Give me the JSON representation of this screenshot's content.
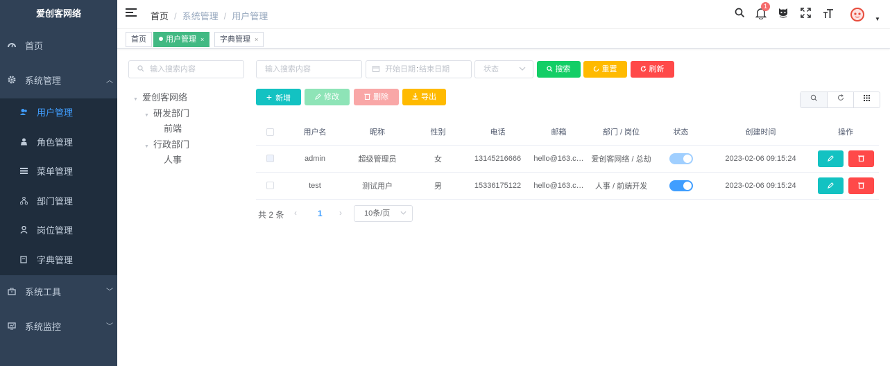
{
  "sidebar": {
    "logo": "爱创客网络",
    "menu": [
      {
        "label": "首页",
        "icon": "dashboard-icon"
      },
      {
        "label": "系统管理",
        "icon": "gear-icon",
        "expanded": true
      },
      {
        "label": "系统工具",
        "icon": "toolbox-icon"
      },
      {
        "label": "系统监控",
        "icon": "monitor-icon"
      }
    ],
    "submenu": [
      {
        "label": "用户管理",
        "icon": "user-icon",
        "active": true
      },
      {
        "label": "角色管理",
        "icon": "role-icon"
      },
      {
        "label": "菜单管理",
        "icon": "menu-icon"
      },
      {
        "label": "部门管理",
        "icon": "org-icon"
      },
      {
        "label": "岗位管理",
        "icon": "post-icon"
      },
      {
        "label": "字典管理",
        "icon": "dict-icon"
      }
    ]
  },
  "navbar": {
    "breadcrumb": [
      "首页",
      "系统管理",
      "用户管理"
    ],
    "bell_badge": "1",
    "icons": [
      "search-icon",
      "bell-icon",
      "github-icon",
      "fullscreen-icon",
      "font-size-icon",
      "avatar-icon"
    ]
  },
  "tags": [
    {
      "label": "首页"
    },
    {
      "label": "用户管理",
      "active": true
    },
    {
      "label": "字典管理"
    }
  ],
  "tree": {
    "search_placeholder": "输入搜索内容",
    "nodes": [
      {
        "label": "爱创客网络",
        "level": 0,
        "expanded": true
      },
      {
        "label": "研发部门",
        "level": 1,
        "expanded": true
      },
      {
        "label": "前端",
        "level": 2
      },
      {
        "label": "行政部门",
        "level": 1,
        "expanded": true
      },
      {
        "label": "人事",
        "level": 2
      }
    ]
  },
  "filters": {
    "keyword_placeholder": "输入搜索内容",
    "start_placeholder": "开始日期",
    "range_separator": ":",
    "end_placeholder": "结束日期",
    "status_placeholder": "状态",
    "search_label": "搜索",
    "reset_label": "重置",
    "refresh_label": "刷新"
  },
  "toolbar": {
    "add_label": "新增",
    "edit_label": "修改",
    "delete_label": "删除",
    "export_label": "导出"
  },
  "table": {
    "columns": [
      "用户名",
      "昵称",
      "性别",
      "电话",
      "邮箱",
      "部门 / 岗位",
      "状态",
      "创建时间",
      "操作"
    ],
    "rows": [
      {
        "username": "admin",
        "nickname": "超级管理员",
        "gender": "女",
        "phone": "13145216666",
        "email": "hello@163.c…",
        "dept": "爱创客网络 / 总劫",
        "enabled": true,
        "disabled_row": true,
        "created": "2023-02-06 09:15:24"
      },
      {
        "username": "test",
        "nickname": "测试用户",
        "gender": "男",
        "phone": "15336175122",
        "email": "hello@163.c…",
        "dept": "人事 / 前端开发",
        "enabled": true,
        "disabled_row": false,
        "created": "2023-02-06 09:15:24"
      }
    ]
  },
  "pagination": {
    "total_text": "共 2 条",
    "current_page": "1",
    "page_size": "10条/页"
  },
  "colors": {
    "sidebar_bg": "#304156",
    "submenu_bg": "#1f2d3d",
    "active_tag": "#42b983",
    "primary": "#409eff",
    "success": "#13ce66",
    "warning": "#ffba00",
    "danger": "#ff4949"
  }
}
